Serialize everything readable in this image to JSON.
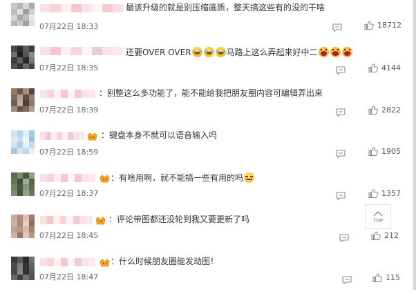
{
  "comments": [
    {
      "text_parts": [
        {
          "t": "text",
          "v": "最该升级的就是别压缩画质，整天搞这些有的没的干啥"
        }
      ],
      "time": "07月22日 18:33",
      "likes": "18712",
      "avatar_colors": [
        "#c9c9c9",
        "#b3b3b3",
        "#d9d9d9",
        "#a8a8a8",
        "#bdbdbd",
        "#e0e0e0",
        "#9e9e9e",
        "#cfcfcf",
        "#d3d3d3",
        "#aaaaaa",
        "#c2c2c2",
        "#e6e6e6",
        "#b8b8b8",
        "#cccccc",
        "#a1a1a1",
        "#dedede"
      ],
      "name_colors": [
        "#fbe0e4",
        "#f6d4da",
        "#fdeef0",
        "#f3c7cf",
        "#f9e3e7",
        "#fff4f5",
        "#f1cbd2",
        "#f8dde2"
      ]
    },
    {
      "text_parts": [
        {
          "t": "text",
          "v": "还要OVER OVER"
        },
        {
          "t": "emoji",
          "v": "laugh-cry-emoji"
        },
        {
          "t": "emoji",
          "v": "laugh-cry-emoji"
        },
        {
          "t": "emoji",
          "v": "laugh-cry-emoji"
        },
        {
          "t": "text",
          "v": "马路上这么弄起来好中二"
        },
        {
          "t": "emoji",
          "v": "roar-emoji"
        },
        {
          "t": "emoji",
          "v": "roar-emoji"
        },
        {
          "t": "emoji",
          "v": "roar-emoji"
        }
      ],
      "time": "07月22日 18:35",
      "likes": "4144",
      "avatar_colors": [
        "#4a4a4a",
        "#2e2e2e",
        "#5d5d5d",
        "#3a3a3a",
        "#6f6f6f",
        "#1f1f1f",
        "#565656",
        "#8a8a8a",
        "#3d3d3d",
        "#626262",
        "#2a2a2a",
        "#7a7a7a",
        "#505050",
        "#353535",
        "#6a6a6a",
        "#444444"
      ],
      "name_colors": [
        "#fbe0e4",
        "#f3c7cf",
        "#fdeef0",
        "#f6d4da",
        "#fff4f5",
        "#f1cbd2",
        "#f9e3e7",
        "#fde8ec"
      ]
    },
    {
      "text_parts": [
        {
          "t": "text",
          "v": "：别整这么多功能了，能不能给我把朋友圈内容可编辑弄出来"
        }
      ],
      "time": "07月22日 18:39",
      "likes": "2822",
      "avatar_colors": [
        "#8c7a6b",
        "#6b5a4c",
        "#a3907f",
        "#574639",
        "#7e6c5e",
        "#b5a291",
        "#5f4e41",
        "#94816f",
        "#6e5d4f",
        "#c2b09f",
        "#4f3f33",
        "#8a7868",
        "#a08d7c",
        "#65544a",
        "#7b695a",
        "#b09d8c"
      ],
      "name_colors": [
        "#fbe0e4",
        "#f6d4da",
        "#fdeef0",
        "#f3c7cf",
        "#fff4f5",
        "#f1cbd2",
        "#f9e3e7",
        "#fde8ec"
      ]
    },
    {
      "text_parts": [
        {
          "t": "text",
          "v": "：键盘本身不就可以语音输入吗"
        }
      ],
      "time": "07月22日 18:59",
      "likes": "1905",
      "avatar_colors": [
        "#cfe3f0",
        "#b6d4ea",
        "#e0eef7",
        "#a9c9e2",
        "#dbe9f4",
        "#c3dbec",
        "#eef6fb",
        "#9fc1dc",
        "#d2e5f1",
        "#b0cfe7",
        "#e6f1f8",
        "#c8deee",
        "#a4c5df",
        "#d7e8f3",
        "#bcd7eb",
        "#e9f3f9"
      ],
      "name_colors": [
        "#fbe0e4",
        "#f3c7cf",
        "#fdeef0",
        "#f6d4da",
        "#fff4f5",
        "#f1cbd2",
        "#f9e3e7",
        "#fde8ec"
      ],
      "badge": true
    },
    {
      "text_parts": [
        {
          "t": "text",
          "v": "：有啥用啊，就不能搞一些有用的吗"
        },
        {
          "t": "emoji",
          "v": "smug-emoji"
        }
      ],
      "time": "07月22日 18:37",
      "likes": "1357",
      "avatar_colors": [
        "#5b6b4f",
        "#7a8a6b",
        "#4a5a3f",
        "#8f9f80",
        "#66765a",
        "#3f4f35",
        "#a0ae92",
        "#56664a",
        "#718163",
        "#495a3e",
        "#889878",
        "#5f6f53",
        "#7d8d6e",
        "#445438",
        "#94a485",
        "#6a7a5d"
      ],
      "name_colors": [
        "#fbe0e4",
        "#f6d4da",
        "#fdeef0",
        "#f3c7cf",
        "#fff4f5",
        "#f1cbd2",
        "#f9e3e7",
        "#fde8ec"
      ],
      "badge": true
    },
    {
      "text_parts": [
        {
          "t": "text",
          "v": "：评论带图都还没轮到我又要更新了吗"
        }
      ],
      "time": "07月22日 18:45",
      "likes": "212",
      "avatar_colors": [
        "#c9a99a",
        "#b08e7e",
        "#dcbfb1",
        "#9c7a6a",
        "#d1b2a4",
        "#a98878",
        "#e6cfc4",
        "#8f6e5f",
        "#c0a091",
        "#b79686",
        "#d8bbad",
        "#a38272",
        "#cdb0a2",
        "#967566",
        "#e0c7bb",
        "#b99a8b"
      ],
      "name_colors": [
        "#fbe0e4",
        "#f3c7cf",
        "#fdeef0",
        "#f6d4da",
        "#fff4f5",
        "#f1cbd2",
        "#f9e3e7",
        "#fde8ec"
      ],
      "badge": true
    },
    {
      "text_parts": [
        {
          "t": "text",
          "v": "：什么时候朋友圈能发动图！"
        }
      ],
      "time": "07月22日 18:47",
      "likes": "115",
      "avatar_colors": [
        "#3c3c3c",
        "#5a5a5a",
        "#2b2b2b",
        "#6e6e6e",
        "#4b4b4b",
        "#7f7f7f",
        "#333333",
        "#616161",
        "#474747",
        "#8a8a8a",
        "#2f2f2f",
        "#585858",
        "#6a6a6a",
        "#3f3f3f",
        "#747474",
        "#525252"
      ],
      "name_colors": [
        "#fbe0e4",
        "#f6d4da",
        "#fdeef0",
        "#f3c7cf",
        "#fff4f5",
        "#f1cbd2",
        "#f9e3e7",
        "#fde8ec"
      ],
      "badge": true
    }
  ],
  "back_to_top_label": "TOP",
  "colors": {
    "like_icon": "#888888",
    "reply_icon": "#888888",
    "badge": "#f5a623"
  }
}
